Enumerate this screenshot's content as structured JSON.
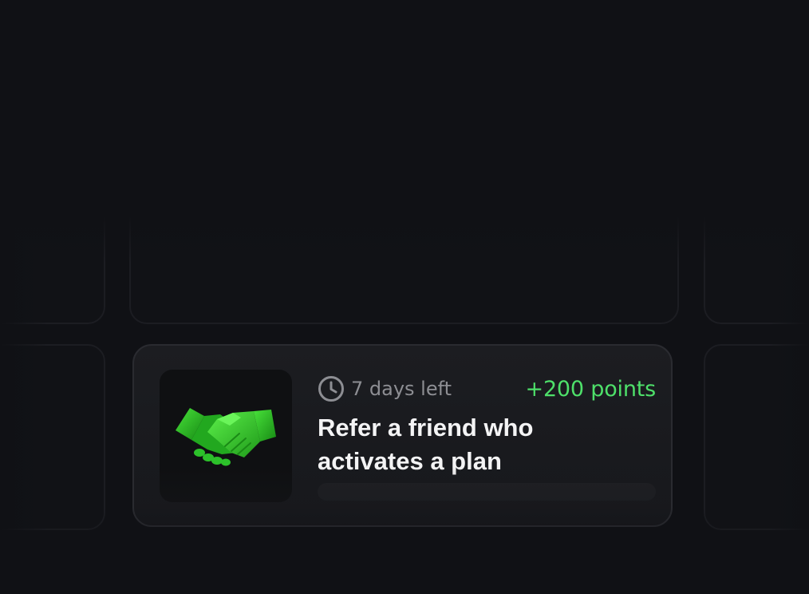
{
  "task": {
    "image_icon": "handshake-icon",
    "time_icon": "clock-icon",
    "time_left": "7 days left",
    "points": "+200 points",
    "title": "Refer a friend who activates a plan",
    "progress": 0
  },
  "colors": {
    "background": "#101115",
    "card": "#1a1b1f",
    "accent": "#4ee06a",
    "muted_text": "#8d8e93",
    "title_text": "#f4f4f5"
  }
}
